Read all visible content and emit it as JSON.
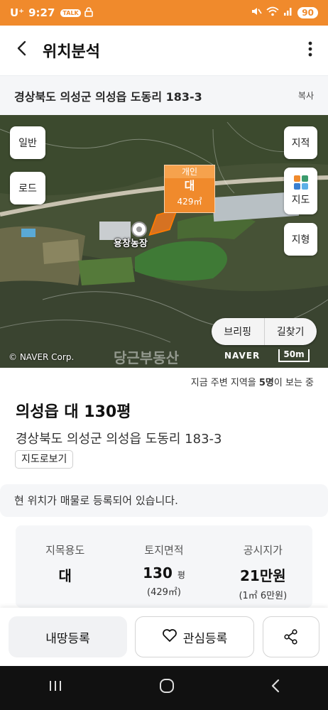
{
  "status_bar": {
    "carrier": "U⁺",
    "time": "9:27",
    "talk_badge": "TALK",
    "battery": "90"
  },
  "header": {
    "back_icon": "chevron-left-icon",
    "title": "위치분석",
    "more_icon": "more-vertical-icon"
  },
  "address_bar": {
    "address": "경상북도 의성군 의성읍 도동리 183-3",
    "copy_label": "복사"
  },
  "map": {
    "left_buttons": [
      "일반",
      "로드"
    ],
    "right_buttons": {
      "cadastral": "지적",
      "map_kind": "지도",
      "terrain": "지형"
    },
    "marker": {
      "owner": "개인",
      "jimok": "대",
      "area": "429㎡"
    },
    "poi_label": "용창농장",
    "briefing_label": "브리핑",
    "directions_label": "길찾기",
    "copyright": "© NAVER Corp.",
    "watermark": "당근부동산",
    "naver_logo": "NAVER",
    "scale_label": "50m",
    "accent_color": "#f08a2c"
  },
  "info": {
    "viewers_prefix": "지금 주변 지역을 ",
    "viewers_count": "5명",
    "viewers_suffix": "이 보는 중",
    "title": "의성읍 대 130평",
    "address": "경상북도 의성군 의성읍 도동리 183-3",
    "map_view_button": "지도로보기",
    "notice": "현 위치가 매물로 등록되어 있습니다."
  },
  "stats": [
    {
      "label": "지목용도",
      "value": "대",
      "unit": "",
      "sub": ""
    },
    {
      "label": "토지면적",
      "value": "130",
      "unit": "평",
      "sub": "(429㎡)"
    },
    {
      "label": "공시지가",
      "value": "21만원",
      "unit": "",
      "sub": "(1㎡ 6만원)"
    }
  ],
  "actions": {
    "register": "내땅등록",
    "interest": "관심등록",
    "share_icon": "share-icon",
    "heart_icon": "heart-outline-icon"
  },
  "navbar": {
    "recents_icon": "recents-icon",
    "home_icon": "home-circle-icon",
    "back_icon": "back-chevron-icon"
  }
}
